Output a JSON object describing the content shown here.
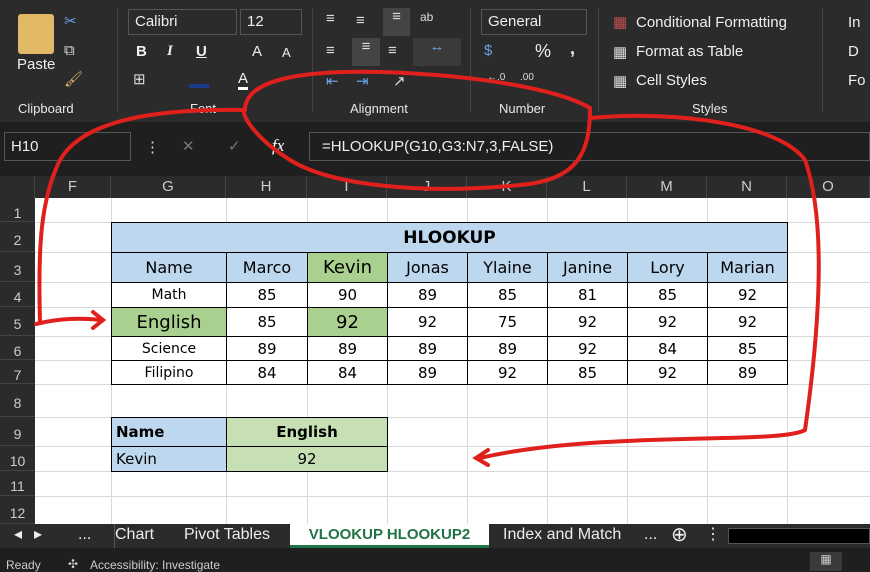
{
  "ribbon": {
    "clipboard": {
      "paste": "Paste",
      "label": "Clipboard"
    },
    "font": {
      "name": "Calibri",
      "size": "12",
      "bold": "B",
      "italic": "I",
      "underline": "U",
      "grow": "A",
      "shrink": "A",
      "label": "Font"
    },
    "alignment": {
      "label": "Alignment"
    },
    "number": {
      "format": "General",
      "percent": "%",
      "comma": ",",
      "label": "Number"
    },
    "styles": {
      "conditional": "Conditional Formatting",
      "table": "Format as Table",
      "cell": "Cell Styles",
      "label": "Styles"
    },
    "cells": {
      "insert": "In",
      "delete": "D",
      "format": "Fo"
    }
  },
  "formula_bar": {
    "name_box": "H10",
    "fx": "fx",
    "formula": "=HLOOKUP(G10,G3:N7,3,FALSE)"
  },
  "columns": [
    "F",
    "G",
    "H",
    "I",
    "J",
    "K",
    "L",
    "M",
    "N",
    "O"
  ],
  "rows": [
    "1",
    "2",
    "3",
    "4",
    "5",
    "6",
    "7",
    "8",
    "9",
    "10",
    "11",
    "12"
  ],
  "table": {
    "title": "HLOOKUP",
    "header": [
      "Name",
      "Marco",
      "Kevin",
      "Jonas",
      "Ylaine",
      "Janine",
      "Lory",
      "Marian"
    ],
    "body": [
      [
        "Math",
        "85",
        "90",
        "89",
        "85",
        "81",
        "85",
        "92"
      ],
      [
        "English",
        "85",
        "92",
        "92",
        "75",
        "92",
        "92",
        "92"
      ],
      [
        "Science",
        "89",
        "89",
        "89",
        "89",
        "92",
        "84",
        "85"
      ],
      [
        "Filipino",
        "84",
        "84",
        "89",
        "92",
        "85",
        "92",
        "89"
      ]
    ]
  },
  "lookup": {
    "name_label": "Name",
    "subject_label": "English",
    "name_value": "Kevin",
    "result": "92"
  },
  "sheet_tabs": {
    "more": "...",
    "tabs": [
      "Chart",
      "Pivot Tables",
      "VLOOKUP HLOOKUP2",
      "Index and Match"
    ],
    "active": "VLOOKUP HLOOKUP2",
    "more_right": "..."
  },
  "status": {
    "ready": "Ready",
    "accessibility": "Accessibility: Investigate"
  },
  "colors": {
    "header_blue": "#bdd7ee",
    "highlight_green": "#a9d08e",
    "light_green": "#c6e0b4",
    "accent": "#217346",
    "annotation": "#e0201c"
  }
}
